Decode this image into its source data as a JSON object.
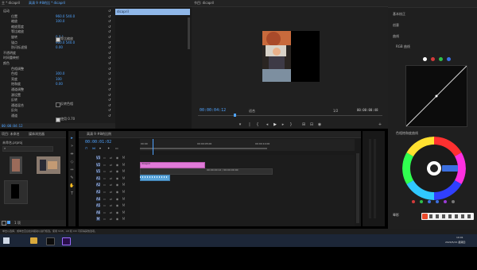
{
  "effect_controls": {
    "tab_label": "主 * dicapril",
    "tab_active": "高清 9 #8的比 * dicapril",
    "rows": [
      {
        "label": "运动",
        "value": ""
      },
      {
        "label": "位置",
        "value": "960.0    540.0"
      },
      {
        "label": "缩放",
        "value": "100.0"
      },
      {
        "label": "缩放宽度",
        "value": ""
      },
      {
        "label": "等比缩放",
        "value": ""
      },
      {
        "label": "旋转",
        "value": "0.0 °"
      },
      {
        "label": "锚点",
        "value": "960.0    540.0"
      },
      {
        "label": "防闪烁滤镜",
        "value": "0.00"
      },
      {
        "label": "不透明度",
        "value": ""
      },
      {
        "label": "时间重映射",
        "value": ""
      },
      {
        "label": "颜色",
        "value": ""
      },
      {
        "label": "色相调整",
        "value": ""
      },
      {
        "label": "色相",
        "value": "300.0"
      },
      {
        "label": "亮度",
        "value": "100"
      },
      {
        "label": "饱和度",
        "value": "0.00"
      },
      {
        "label": "通道调整",
        "value": ""
      },
      {
        "label": "源设置",
        "value": ""
      },
      {
        "label": "反转",
        "value": ""
      },
      {
        "label": "通道混合",
        "value": ""
      },
      {
        "label": "反向",
        "value": ""
      },
      {
        "label": "通道",
        "value": ""
      }
    ],
    "checkbox_label_1": "等比缩放",
    "checkbox_label_2": "反转色相",
    "checkbox_label_3": "使用 0.70",
    "footer_tc": "00:00:04:12",
    "source_clip": "dicapril"
  },
  "program": {
    "tab": "节目: dicapril",
    "timecode_left": "00:00:04:12",
    "fit_label": "适合",
    "quality": "1/2",
    "timecode_right": "00:00:00:48"
  },
  "lumetri": {
    "rows": [
      {
        "label": "基本校正"
      },
      {
        "label": "创意"
      },
      {
        "label": "曲线"
      }
    ],
    "section": "RGB 曲线",
    "section2": "色相饱和度曲线",
    "bottom_label": "晕影"
  },
  "project": {
    "tabs": [
      "项目: 未命名",
      "媒体浏览器"
    ],
    "name": "未命名.prproj",
    "search_placeholder": "",
    "footer": "1 项"
  },
  "sequence": {
    "tab": "高清 9 #8的比例",
    "timecode": "00:00:01:02",
    "ruler_marks": [
      "00:00",
      "00:00:05:00",
      "00:00:10:00"
    ],
    "tracks": [
      {
        "id": "V3"
      },
      {
        "id": "V2"
      },
      {
        "id": "V1"
      },
      {
        "id": "A1"
      },
      {
        "id": "A2"
      },
      {
        "id": "A3"
      },
      {
        "id": "A4"
      },
      {
        "id": "A5"
      },
      {
        "id": "A6"
      },
      {
        "id": "M"
      }
    ],
    "clip_label": "00:00:00:12 / 00:00:00:00",
    "clip_v2": "dicapril",
    "source_label": "V1"
  },
  "status": {
    "message": "单击以选择，或单击空白处并拖动以进行框选。使用 Shift、Alt 和 Ctrl 可获得其他选项。"
  },
  "taskbar": {
    "time": "10:01",
    "date": "2020/5/21 星期四"
  },
  "colors": {
    "accent": "#4fa3ff",
    "clip_pink": "#e07ad8",
    "clip_blue": "#5aa4d8",
    "panel_bg": "#1d1d1d"
  }
}
